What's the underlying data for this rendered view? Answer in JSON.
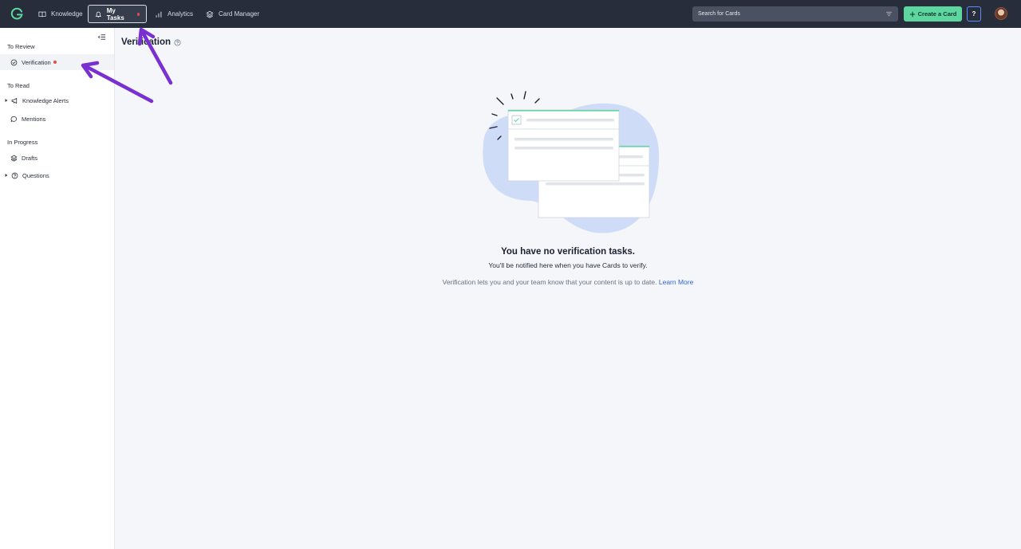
{
  "topbar": {
    "nav": [
      {
        "label": "Knowledge",
        "icon": "book-icon"
      },
      {
        "label": "My Tasks",
        "icon": "bell-icon",
        "active": true,
        "has_alert": true
      },
      {
        "label": "Analytics",
        "icon": "bar-chart-icon"
      },
      {
        "label": "Card Manager",
        "icon": "stack-icon"
      }
    ],
    "search_placeholder": "Search for Cards",
    "create_label": "Create a Card",
    "help_label": "?"
  },
  "sidebar": {
    "sections": [
      {
        "title": "To Review",
        "items": [
          {
            "label": "Verification",
            "icon": "check-circle-icon",
            "active": true,
            "has_alert": true
          }
        ]
      },
      {
        "title": "To Read",
        "items": [
          {
            "label": "Knowledge Alerts",
            "icon": "megaphone-icon",
            "expandable": true
          },
          {
            "label": "Mentions",
            "icon": "speech-bubble-icon"
          }
        ]
      },
      {
        "title": "In Progress",
        "items": [
          {
            "label": "Drafts",
            "icon": "stack-icon"
          },
          {
            "label": "Questions",
            "icon": "question-circle-icon",
            "expandable": true
          }
        ]
      }
    ]
  },
  "main": {
    "title": "Verification",
    "empty_title": "You have no verification tasks.",
    "empty_sub": "You'll be notified here when you have Cards to verify.",
    "empty_note": "Verification lets you and your team know that your content is up to date.",
    "learn_more": "Learn More"
  },
  "colors": {
    "topbar_bg": "#272d3b",
    "accent_green": "#5dd6a0",
    "alert_red": "#e54b4b",
    "link_blue": "#2f64d6",
    "annotation_purple": "#7a2fd0"
  }
}
